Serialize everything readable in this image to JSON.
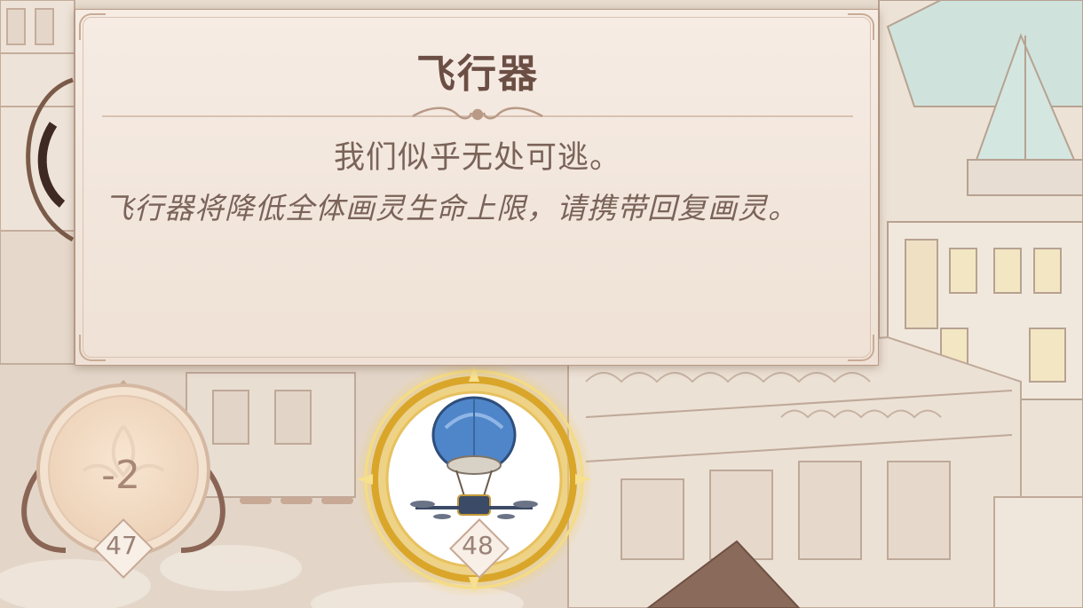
{
  "event": {
    "title": "飞行器",
    "flavor": "我们似乎无处可逃。",
    "effect": "飞行器将降低全体画灵生命上限，请携带回复画灵。"
  },
  "map": {
    "nodes": [
      {
        "number": "47",
        "cost": "-2",
        "icon": "empty-emblem-icon",
        "state": "visited"
      },
      {
        "number": "48",
        "icon": "airship-icon",
        "state": "current"
      }
    ]
  },
  "colors": {
    "card_bg": "#f3e8de",
    "text_brown": "#6b4e44",
    "gold_glow": "#f0c64a",
    "balloon_blue": "#4f86c9"
  }
}
